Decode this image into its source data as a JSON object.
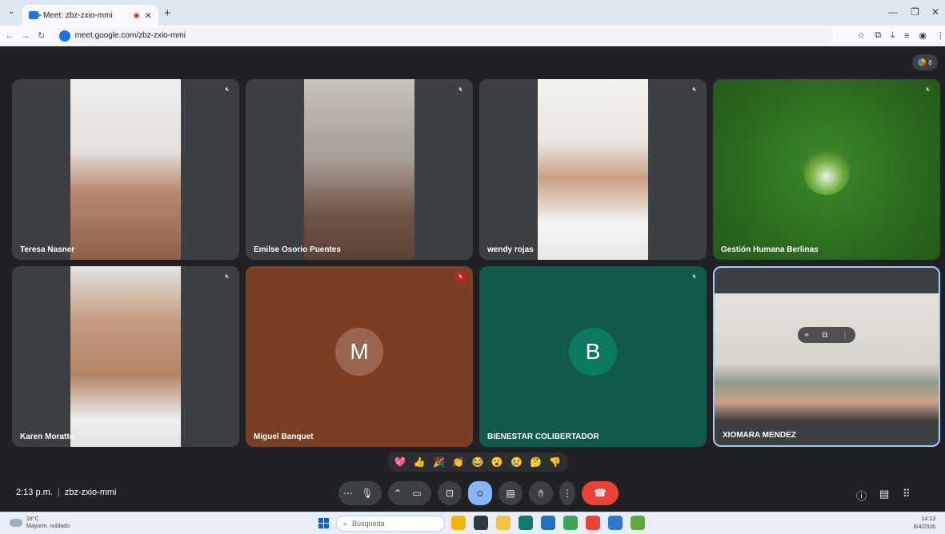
{
  "browser": {
    "tab_title": "Meet: zbz-zxio-mmi",
    "url": "meet.google.com/zbz-zxio-mmi",
    "new_tab_icon": "plus-icon"
  },
  "meet": {
    "participant_count": "8",
    "tiles": [
      {
        "name": "Teresa Nasner",
        "muted": true
      },
      {
        "name": "Emilse Osorio Puentes",
        "muted": true
      },
      {
        "name": "wendy rojas",
        "muted": true
      },
      {
        "name": "Gestión Humana Berlinas",
        "muted": true
      },
      {
        "name": "Karen Moratto",
        "muted": true
      },
      {
        "name": "Miguel Banquet",
        "avatar_letter": "M",
        "muted": true
      },
      {
        "name": "BIENESTAR COLIBERTADOR",
        "avatar_letter": "B",
        "muted": true
      },
      {
        "name": "XIOMARA MENDEZ",
        "muted": false
      }
    ],
    "reactions": [
      "💖",
      "👍",
      "🎉",
      "👏",
      "😂",
      "😮",
      "😢",
      "🤔",
      "👎"
    ],
    "time": "2:13 p.m.",
    "meeting_code": "zbz-zxio-mmi"
  },
  "taskbar": {
    "weather_temp": "18°C",
    "weather_desc": "Mayorm. nublado",
    "search_placeholder": "Búsqueda",
    "clock_time": "14:13",
    "clock_date": "8/4/2026"
  },
  "colors": {
    "meet_bg": "#202124",
    "tile_gray": "#3c4043",
    "miguel_bg": "#7a3f22",
    "bienestar_bg": "#0f5a4c",
    "gestion_bg": "#2b6b1e",
    "leave_red": "#ea4335",
    "active_blue": "#8ab4f8"
  }
}
